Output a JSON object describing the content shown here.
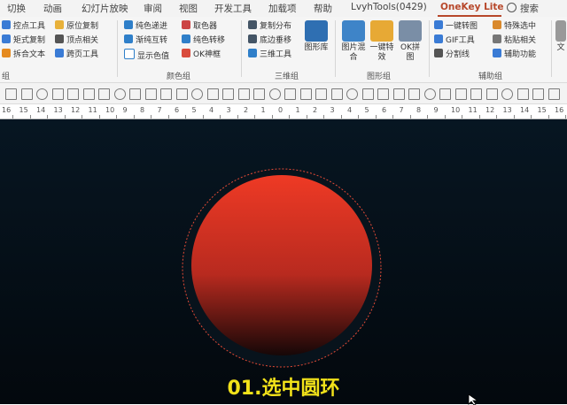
{
  "tabs": [
    "切换",
    "动画",
    "幻灯片放映",
    "审阅",
    "视图",
    "开发工具",
    "加载项",
    "帮助",
    "LvyhTools(0429)",
    "OneKey Lite"
  ],
  "active_tab": "OneKey Lite",
  "search_label": "搜索",
  "ribbon": {
    "g1": {
      "items": [
        "控点工具",
        "矩式复制",
        "拆合文本",
        "原位复制",
        "顶点相关",
        "跨页工具"
      ],
      "label": "组"
    },
    "g2": {
      "items": [
        "纯色递进",
        "渐纯互转",
        "显示色值",
        "取色器",
        "纯色转移",
        "OK神框"
      ],
      "label": "颜色组"
    },
    "g3": {
      "items": [
        "复制分布",
        "底边垂移",
        "三维工具"
      ],
      "big": "图形库",
      "label": "三维组"
    },
    "g4": {
      "bigs": [
        "图片混合",
        "一键特效",
        "OK拼图"
      ],
      "label": "图形组"
    },
    "g5": {
      "items": [
        "一键转图",
        "GIF工具",
        "分割线",
        "特殊选中",
        "粘贴相关",
        "辅助功能"
      ],
      "label": "辅助组"
    },
    "g6": {
      "big": "文"
    }
  },
  "ruler_numbers": [
    "16",
    "15",
    "14",
    "13",
    "12",
    "11",
    "10",
    "9",
    "8",
    "7",
    "6",
    "5",
    "4",
    "3",
    "2",
    "1",
    "0",
    "1",
    "2",
    "3",
    "4",
    "5",
    "6",
    "7",
    "8",
    "9",
    "10",
    "11",
    "12",
    "13",
    "14",
    "15",
    "16"
  ],
  "slide": {
    "caption": "01.选中圆环"
  }
}
